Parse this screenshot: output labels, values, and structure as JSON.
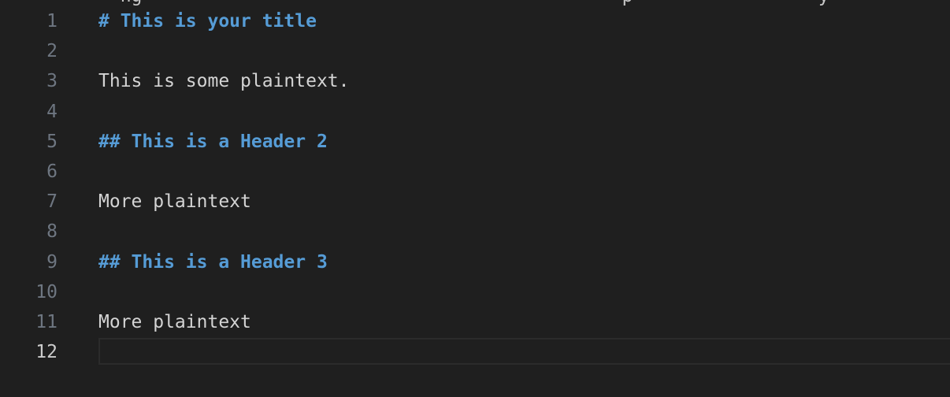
{
  "editor": {
    "top_clipped_text": "  ng                                            p                 y",
    "lines": [
      {
        "number": "1",
        "text": "# This is your title",
        "kind": "heading"
      },
      {
        "number": "2",
        "text": "",
        "kind": "plain"
      },
      {
        "number": "3",
        "text": "This is some plaintext.",
        "kind": "plain"
      },
      {
        "number": "4",
        "text": "",
        "kind": "plain"
      },
      {
        "number": "5",
        "text": "## This is a Header 2",
        "kind": "heading"
      },
      {
        "number": "6",
        "text": "",
        "kind": "plain"
      },
      {
        "number": "7",
        "text": "More plaintext",
        "kind": "plain"
      },
      {
        "number": "8",
        "text": "",
        "kind": "plain"
      },
      {
        "number": "9",
        "text": "## This is a Header 3",
        "kind": "heading"
      },
      {
        "number": "10",
        "text": "",
        "kind": "plain"
      },
      {
        "number": "11",
        "text": "More plaintext",
        "kind": "plain"
      },
      {
        "number": "12",
        "text": "",
        "kind": "plain"
      }
    ],
    "active_line": "12"
  },
  "colors": {
    "background": "#1f1f1f",
    "heading": "#569cd6",
    "plaintext": "#d4d4d4",
    "line_number": "#6e7681",
    "active_line_number": "#cccccc"
  }
}
